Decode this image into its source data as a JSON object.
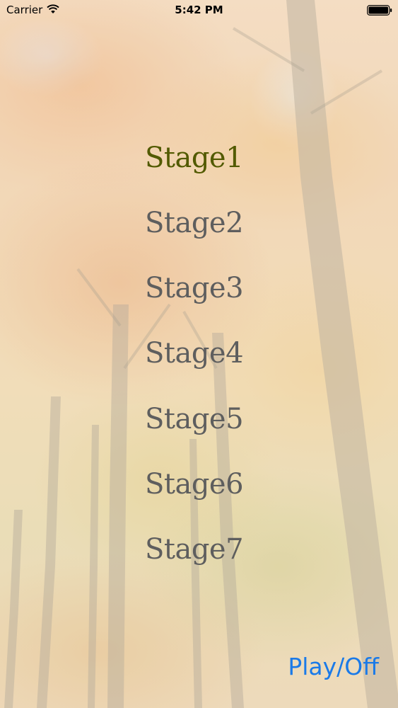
{
  "status_bar": {
    "carrier": "Carrier",
    "time": "5:42 PM",
    "wifi_icon": "wifi-icon",
    "battery_icon": "battery-icon"
  },
  "stages": [
    {
      "label": "Stage1",
      "selected": true
    },
    {
      "label": "Stage2",
      "selected": false
    },
    {
      "label": "Stage3",
      "selected": false
    },
    {
      "label": "Stage4",
      "selected": false
    },
    {
      "label": "Stage5",
      "selected": false
    },
    {
      "label": "Stage6",
      "selected": false
    },
    {
      "label": "Stage7",
      "selected": false
    }
  ],
  "controls": {
    "play_off_label": "Play/Off"
  },
  "colors": {
    "selected_stage": "#525a00",
    "stage": "#5e5e5e",
    "accent": "#1a7ae8"
  }
}
